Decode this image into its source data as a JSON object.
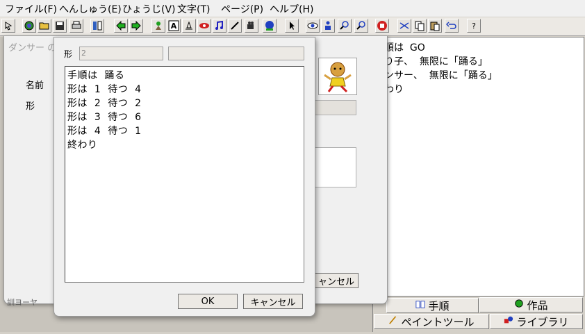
{
  "menu": [
    "ファイル(F)",
    "へんしゅう(E)",
    "ひょうじ(V)",
    "文字(T)",
    "ページ(P)",
    "ヘルプ(H)"
  ],
  "toolbar": {
    "icons": [
      "cursor-icon",
      "globe-icon",
      "open-folder-icon",
      "save-disk-icon",
      "printer-icon",
      "columns-icon",
      "arrow-left-icon",
      "arrow-right-icon",
      "sprite-character-icon",
      "text-a-icon",
      "stamp-icon",
      "eye-red-icon",
      "music-note-icon",
      "syringe-icon",
      "movie-camera-icon",
      "sphere-icon",
      "pointer-icon",
      "eye-blue-icon",
      "figure-icon",
      "zoom-in-icon",
      "zoom-out-icon",
      "stop-hand-icon",
      "scissors-icon",
      "copy-icon",
      "paste-icon",
      "undo-icon",
      "help-icon"
    ],
    "help_label": "?"
  },
  "right_panel": {
    "lines": [
      "順は  GO",
      "り子、  無限に「踊る」",
      "ンサー、  無限に「踊る」",
      "わり"
    ]
  },
  "tabs": {
    "procedure": "手順",
    "work": "作品",
    "paint_tool": "ペイントツール",
    "library": "ライブラリ"
  },
  "dialog1": {
    "title": "ダンサー の",
    "name_label": "名前",
    "shape_label": "形",
    "cancel_label": "ャンセル",
    "status_text": "訓ヨーヤ"
  },
  "dialog2": {
    "shape_label": "形",
    "shape_value": "2",
    "script_lines": [
      "手順は  踊る",
      "形は  1  待つ  4",
      "形は  2  待つ  2",
      "形は  3  待つ  6",
      "形は  4  待つ  1",
      "終わり"
    ],
    "ok_label": "OK",
    "cancel_label": "キャンセル"
  }
}
